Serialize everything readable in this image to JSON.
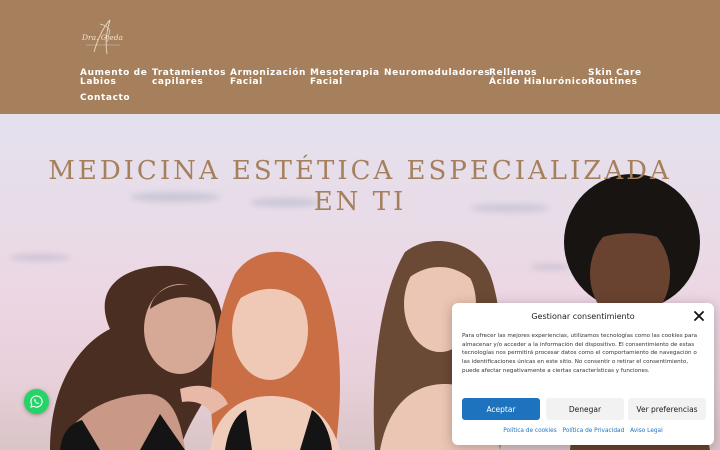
{
  "header": {
    "bg_color": "#a6805c",
    "logo": {
      "icon": "dra-signature-logo",
      "text": "Dra. Ojeda"
    },
    "nav": [
      {
        "id": "labios",
        "lines": [
          "Aumento de",
          "Labios"
        ]
      },
      {
        "id": "capilares",
        "lines": [
          "Tratamientos",
          "capilares"
        ]
      },
      {
        "id": "armonizacion",
        "lines": [
          "Armonización",
          "Facial"
        ]
      },
      {
        "id": "mesoterapia",
        "lines": [
          "Mesoterapia",
          "Facial"
        ]
      },
      {
        "id": "neuromoduladores",
        "lines": [
          "Neuromoduladores",
          ""
        ]
      },
      {
        "id": "rellenos",
        "lines": [
          "Rellenos",
          "Ácido Hialurónico"
        ]
      },
      {
        "id": "skincare",
        "lines": [
          "Skin Care",
          "Routines"
        ]
      },
      {
        "id": "contacto",
        "lines": [
          "Contacto",
          ""
        ]
      }
    ]
  },
  "hero": {
    "title_lines": [
      "MEDICINA ESTÉTICA ESPECIALIZADA",
      "EN TI"
    ],
    "title_color": "#a6805c",
    "image": "four-women-group-portrait"
  },
  "whatsapp": {
    "icon": "whatsapp-icon",
    "color": "#25d366"
  },
  "consent": {
    "title": "Gestionar consentimiento",
    "close_icon": "close-icon",
    "body": "Para ofrecer las mejores experiencias, utilizamos tecnologías como las cookies para almacenar y/o acceder a la información del dispositivo. El consentimiento de estas tecnologías nos permitirá procesar datos como el comportamiento de navegación o las identificaciones únicas en este sitio. No consentir o retirar el consentimiento, puede afectar negativamente a ciertas características y funciones.",
    "buttons": {
      "accept": "Aceptar",
      "deny": "Denegar",
      "preferences": "Ver preferencias"
    },
    "links": [
      "Política de cookies",
      "Política de Privacidad",
      "Aviso Legal"
    ],
    "accent_color": "#1e73be"
  }
}
